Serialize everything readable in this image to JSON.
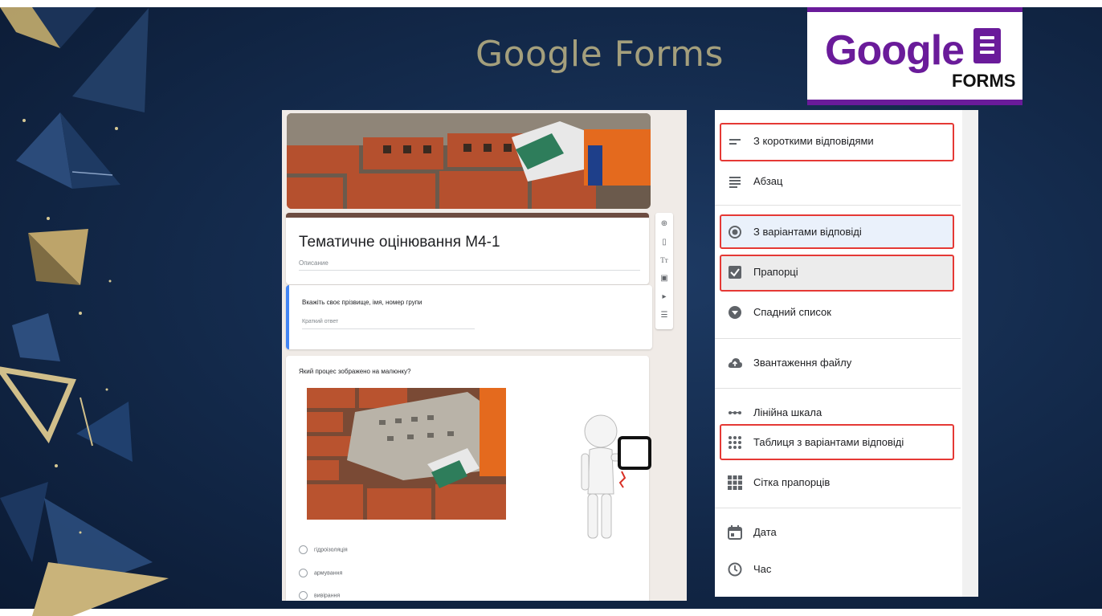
{
  "slide": {
    "title": "Google Forms",
    "logo": {
      "word": "Google",
      "sub": "FORMS",
      "color": "#6a1b9a"
    }
  },
  "form": {
    "title": "Тематичне оцінювання М4-1",
    "description_placeholder": "Описание",
    "question1": {
      "text": "Вкажіть своє прізвище, імя, номер групи",
      "hint": "Краткий ответ"
    },
    "question2": {
      "text": "Який процес зображено на малюнку?",
      "options": [
        "гідроізоляція",
        "армування",
        "вивірання"
      ]
    },
    "toolbar_icons": [
      "add-question-icon",
      "import-icon",
      "title-icon",
      "image-icon",
      "video-icon",
      "section-icon"
    ]
  },
  "menu": {
    "items": [
      {
        "label": "З короткими відповідями",
        "icon": "short-answer-icon",
        "highlighted": true
      },
      {
        "label": "Абзац",
        "icon": "paragraph-icon",
        "highlighted": false
      },
      {
        "label": "З варіантами відповіді",
        "icon": "radio-icon",
        "highlighted": true
      },
      {
        "label": "Прапорці",
        "icon": "checkbox-icon",
        "highlighted": true
      },
      {
        "label": "Спадний список",
        "icon": "dropdown-icon",
        "highlighted": false
      },
      {
        "label": "Звантаження файлу",
        "icon": "upload-icon",
        "highlighted": false
      },
      {
        "label": "Лінійна шкала",
        "icon": "linear-scale-icon",
        "highlighted": false
      },
      {
        "label": "Таблиця з варіантами відповіді",
        "icon": "grid-dots-icon",
        "highlighted": true
      },
      {
        "label": "Сітка прапорців",
        "icon": "grid-icon",
        "highlighted": false
      },
      {
        "label": "Дата",
        "icon": "calendar-icon",
        "highlighted": false
      },
      {
        "label": "Час",
        "icon": "clock-icon",
        "highlighted": false
      }
    ],
    "highlight_color": "#e53935"
  }
}
